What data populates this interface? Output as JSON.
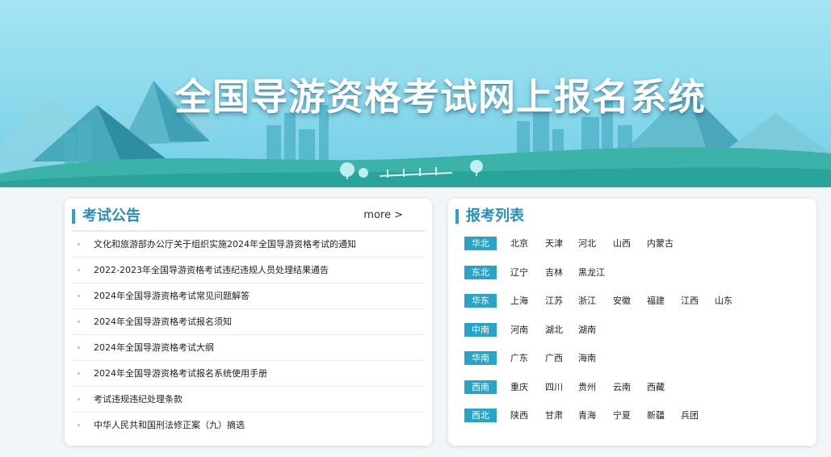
{
  "banner": {
    "title": "全国导游资格考试网上报名系统"
  },
  "notice_panel": {
    "title": "考试公告",
    "more_label": "more >",
    "items": [
      "文化和旅游部办公厅关于组织实施2024年全国导游资格考试的通知",
      "2022-2023年全国导游资格考试违纪违规人员处理结果通告",
      "2024年全国导游资格考试常见问题解答",
      "2024年全国导游资格考试报名须知",
      "2024年全国导游资格考试大纲",
      "2024年全国导游资格考试报名系统使用手册",
      "考试违规违纪处理条款",
      "中华人民共和国刑法修正案（九）摘选"
    ]
  },
  "register_panel": {
    "title": "报考列表",
    "regions": [
      {
        "name": "华北",
        "provinces": [
          "北京",
          "天津",
          "河北",
          "山西",
          "内蒙古"
        ]
      },
      {
        "name": "东北",
        "provinces": [
          "辽宁",
          "吉林",
          "黑龙江"
        ]
      },
      {
        "name": "华东",
        "provinces": [
          "上海",
          "江苏",
          "浙江",
          "安徽",
          "福建",
          "江西",
          "山东"
        ]
      },
      {
        "name": "中南",
        "provinces": [
          "河南",
          "湖北",
          "湖南"
        ]
      },
      {
        "name": "华南",
        "provinces": [
          "广东",
          "广西",
          "海南"
        ]
      },
      {
        "name": "西南",
        "provinces": [
          "重庆",
          "四川",
          "贵州",
          "云南",
          "西藏"
        ]
      },
      {
        "name": "西北",
        "provinces": [
          "陕西",
          "甘肃",
          "青海",
          "宁夏",
          "新疆",
          "兵团"
        ]
      }
    ]
  },
  "colors": {
    "accent": "#2aa3c8",
    "title_blue": "#2a8fb8",
    "sky_top": "#9fe2f2",
    "sky_bottom": "#6fcde6"
  }
}
